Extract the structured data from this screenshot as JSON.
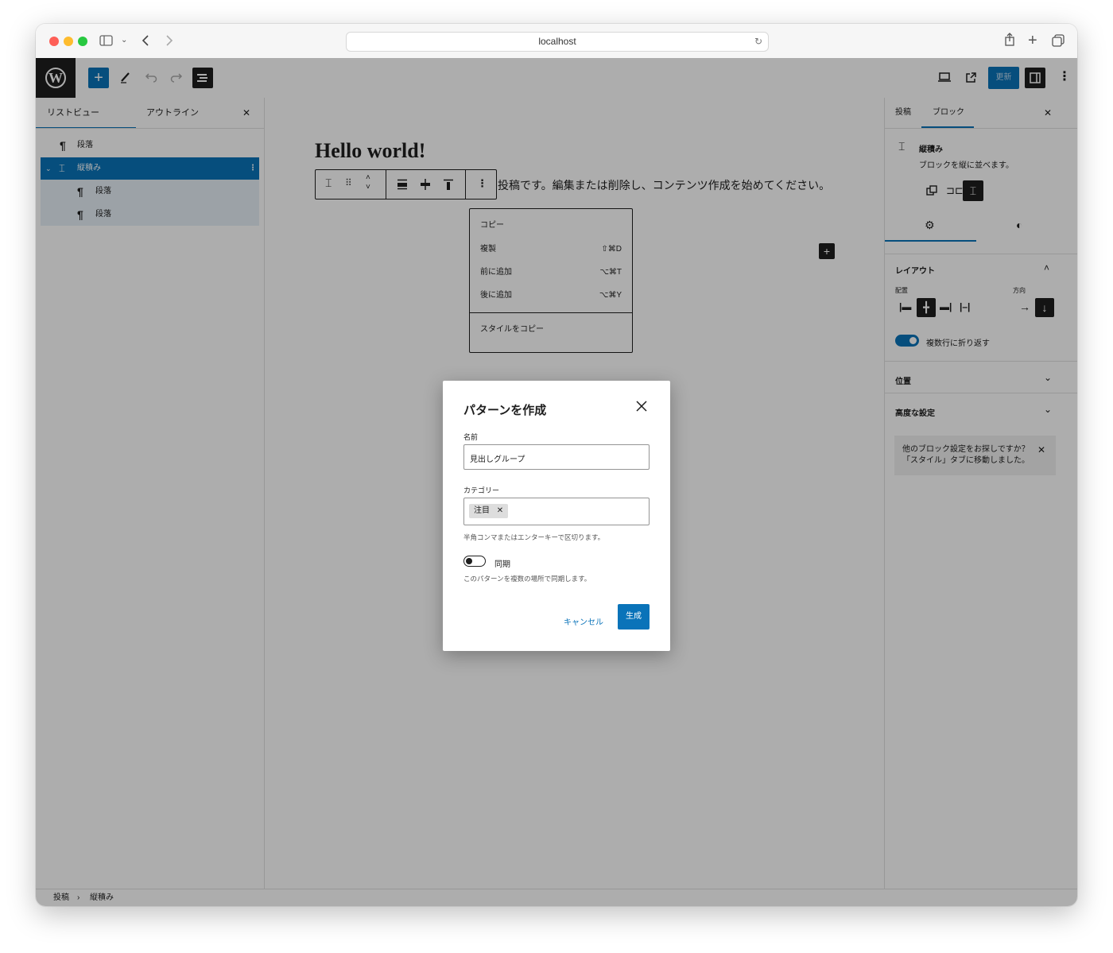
{
  "browser": {
    "url": "localhost"
  },
  "toolbar": {
    "update_label": "更新"
  },
  "left_panel": {
    "tabs": [
      "リストビュー",
      "アウトライン"
    ],
    "close_glyph": "✕",
    "items": [
      {
        "label": "段落",
        "icon": "paragraph-icon"
      },
      {
        "label": "縦積み",
        "icon": "stack-icon",
        "selected": true
      },
      {
        "label": "段落",
        "icon": "paragraph-icon"
      },
      {
        "label": "段落",
        "icon": "paragraph-icon"
      }
    ]
  },
  "canvas": {
    "title": "Hello world!",
    "body_text": "投稿です。編集または削除し、コンテンツ作成を始めてください。",
    "dropdown": [
      {
        "label": "コピー",
        "shortcut": ""
      },
      {
        "label": "複製",
        "shortcut": "⇧⌘D"
      },
      {
        "label": "前に追加",
        "shortcut": "⌥⌘T"
      },
      {
        "label": "後に追加",
        "shortcut": "⌥⌘Y"
      },
      {
        "label": "スタイルをコピー",
        "shortcut": ""
      }
    ]
  },
  "modal": {
    "title": "パターンを作成",
    "name_label": "名前",
    "name_value": "見出しグループ",
    "category_label": "カテゴリー",
    "category_chip": "注目",
    "category_help": "半角コンマまたはエンターキーで区切ります。",
    "sync_label": "同期",
    "sync_help": "このパターンを複数の場所で同期します。",
    "cancel_label": "キャンセル",
    "create_label": "生成"
  },
  "right_panel": {
    "tabs": [
      "投稿",
      "ブロック"
    ],
    "block_name": "縦積み",
    "block_desc": "ブロックを縦に並べます。",
    "layout_heading": "レイアウト",
    "align_label": "配置",
    "direction_label": "方向",
    "wrap_label": "複数行に折り返す",
    "position_heading": "位置",
    "advanced_heading": "高度な設定",
    "notice_text": "他のブロック設定をお探しですか？「スタイル」タブに移動しました。"
  },
  "footer": {
    "crumbs": [
      "投稿",
      "縦積み"
    ],
    "separator": "›"
  },
  "colors": {
    "accent": "#0a73b9",
    "dark": "#1e1e1e"
  }
}
